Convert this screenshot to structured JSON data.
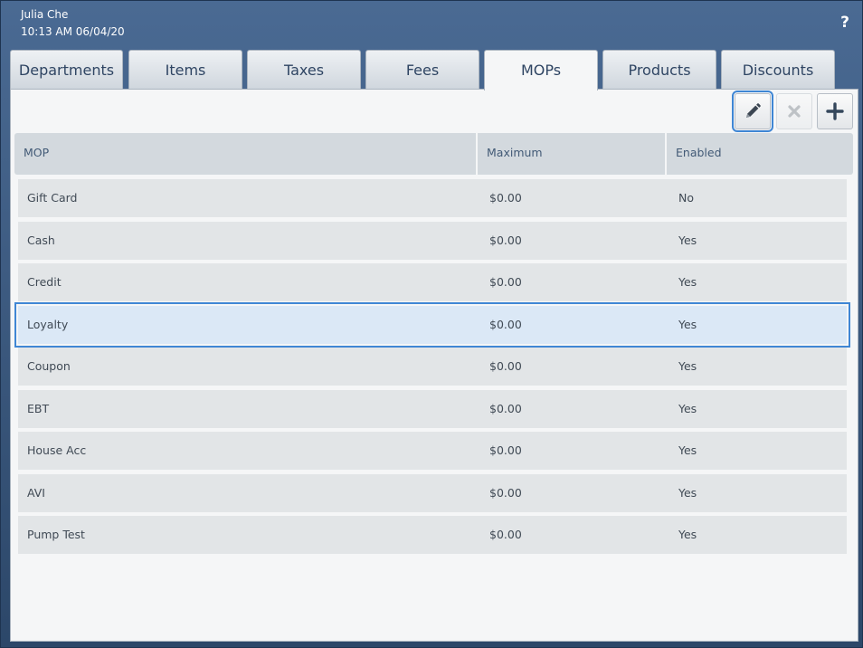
{
  "header": {
    "user_name": "Julia Che",
    "datetime": "10:13 AM 06/04/20",
    "help_label": "?"
  },
  "tabs": [
    {
      "label": "Departments",
      "active": false
    },
    {
      "label": "Items",
      "active": false
    },
    {
      "label": "Taxes",
      "active": false
    },
    {
      "label": "Fees",
      "active": false
    },
    {
      "label": "MOPs",
      "active": true
    },
    {
      "label": "Products",
      "active": false
    },
    {
      "label": "Discounts",
      "active": false
    }
  ],
  "toolbar": {
    "edit_icon": "pencil-icon",
    "delete_icon": "close-icon",
    "add_icon": "plus-icon",
    "delete_disabled": true
  },
  "table": {
    "columns": [
      "MOP",
      "Maximum",
      "Enabled"
    ],
    "rows": [
      {
        "mop": "Gift Card",
        "maximum": "$0.00",
        "enabled": "No",
        "selected": false
      },
      {
        "mop": "Cash",
        "maximum": "$0.00",
        "enabled": "Yes",
        "selected": false
      },
      {
        "mop": "Credit",
        "maximum": "$0.00",
        "enabled": "Yes",
        "selected": false
      },
      {
        "mop": "Loyalty",
        "maximum": "$0.00",
        "enabled": "Yes",
        "selected": true
      },
      {
        "mop": "Coupon",
        "maximum": "$0.00",
        "enabled": "Yes",
        "selected": false
      },
      {
        "mop": "EBT",
        "maximum": "$0.00",
        "enabled": "Yes",
        "selected": false
      },
      {
        "mop": "House Acc",
        "maximum": "$0.00",
        "enabled": "Yes",
        "selected": false
      },
      {
        "mop": "AVI",
        "maximum": "$0.00",
        "enabled": "Yes",
        "selected": false
      },
      {
        "mop": "Pump Test",
        "maximum": "$0.00",
        "enabled": "Yes",
        "selected": false
      }
    ]
  },
  "colors": {
    "header_bg": "#3d5b82",
    "selection_outline": "#3f86d4",
    "selected_row_bg": "#dbe8f6",
    "tab_text": "#2f4563"
  }
}
